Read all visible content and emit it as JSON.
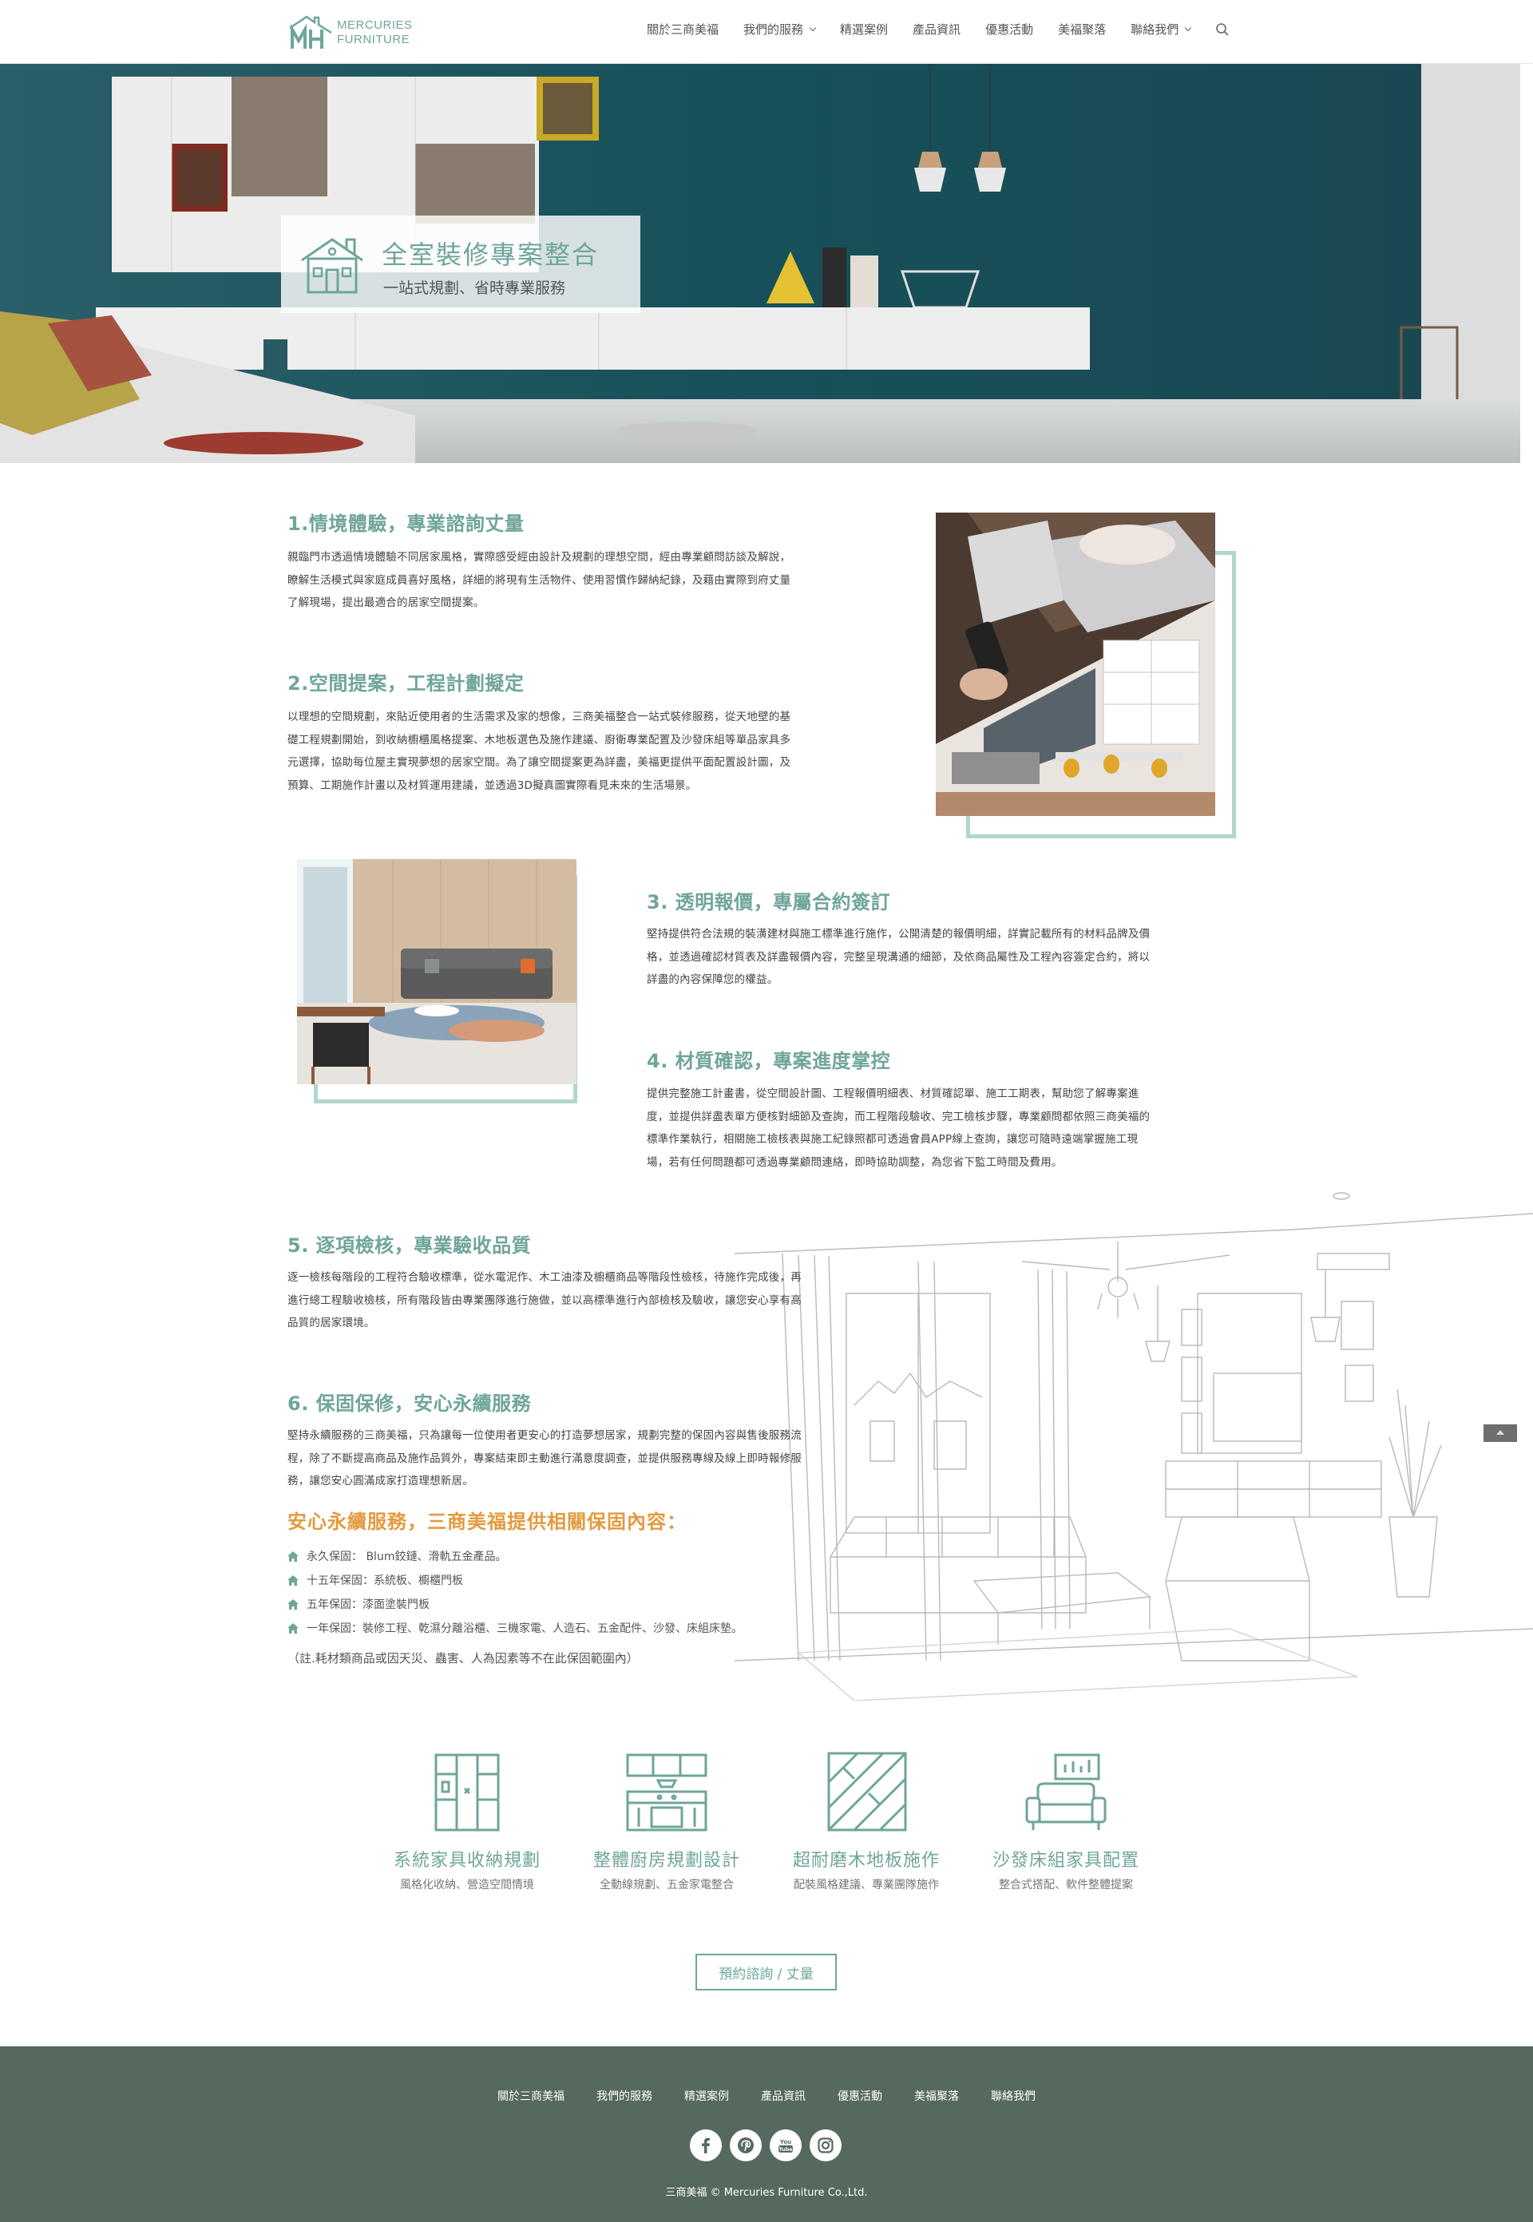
{
  "header": {
    "logo_line1": "MERCURIES",
    "logo_line2": "FURNITURE",
    "nav": [
      {
        "label": "關於三商美福"
      },
      {
        "label": "我們的服務"
      },
      {
        "label": "精選案例"
      },
      {
        "label": "產品資訊"
      },
      {
        "label": "優惠活動"
      },
      {
        "label": "美福聚落"
      },
      {
        "label": "聯絡我們"
      }
    ],
    "search_icon": "search-icon"
  },
  "hero": {
    "title": "全室裝修專案整合",
    "subtitle": "一站式規劃、省時專業服務"
  },
  "sections": [
    {
      "title": "1.情境體驗，專業諮詢丈量",
      "lines": [
        "親臨門市透過情境體驗不同居家風格，實際感受經由設計及規劃的理想空間，經由專業顧問訪談及解說，",
        "瞭解生活模式與家庭成員喜好風格，詳細的將現有生活物件、使用習慣作歸納紀錄，及藉由實際到府丈量",
        "了解現場，提出最適合的居家空間提案。"
      ]
    },
    {
      "title": "2.空間提案，工程計劃擬定",
      "lines": [
        "以理想的空間規劃，來貼近使用者的生活需求及家的想像，三商美福整合一站式裝修服務，從天地壁的基",
        "礎工程規劃開始，到收納櫥櫃風格提案、木地板選色及施作建議、廚衛專業配置及沙發床組等單品家具多",
        "元選擇，協助每位屋主實現夢想的居家空間。為了讓空間提案更為詳盡，美福更提供平面配置設計圖，及",
        "預算、工期施作計畫以及材質運用建議，並透過3D擬真圖實際看見未來的生活場景。"
      ]
    },
    {
      "title": "3. 透明報價，專屬合約簽訂",
      "lines": [
        "堅持提供符合法規的裝潢建材與施工標準進行施作，公開清楚的報價明細，詳實記載所有的材料品牌及價",
        "格，並透過確認材質表及詳盡報價內容，完整呈現溝通的細節，及依商品屬性及工程內容簽定合約，將以",
        "詳盡的內容保障您的權益。"
      ]
    },
    {
      "title": "4. 材質確認，專案進度掌控",
      "lines": [
        "提供完整施工計畫書，從空間設計圖、工程報價明細表、材質確認單、施工工期表，幫助您了解專案進",
        "度，並提供詳盡表單方便核對細節及查詢，而工程階段驗收、完工檢核步驟，專業顧問都依照三商美福的",
        "標準作業執行，相關施工檢核表與施工紀錄照都可透過會員APP線上查詢，讓您可隨時遠端掌握施工現",
        "場，若有任何問題都可透過專業顧問連絡，即時協助調整，為您省下監工時間及費用。"
      ]
    },
    {
      "title": "5. 逐項檢核，專業驗收品質",
      "lines": [
        "逐一檢核每階段的工程符合驗收標準，從水電泥作、木工油漆及櫥櫃商品等階段性檢核，待施作完成後，再",
        "進行總工程驗收檢核，所有階段皆由專業團隊進行施做，並以高標準進行內部檢核及驗收，讓您安心享有高",
        "品質的居家環境。"
      ]
    },
    {
      "title": "6. 保固保修，安心永續服務",
      "lines": [
        "堅持永續服務的三商美福，只為讓每一位使用者更安心的打造夢想居家，規劃完整的保固內容與售後服務流",
        "程，除了不斷提高商品及施作品質外，專案結束即主動進行滿意度調查，並提供服務專線及線上即時報修服",
        "務，讓您安心圓滿成家打造理想新居。"
      ]
    }
  ],
  "guarantee": {
    "title": "安心永續服務，三商美福提供相關保固內容：",
    "items": [
      "永久保固： Blum鉸鏈、滑軌五金產品。",
      "十五年保固：系統板、櫥櫃門板",
      "五年保固：漆面塗裝門板",
      "一年保固：裝修工程、乾濕分離浴櫃、三機家電、人造石、五金配件、沙發、床組床墊。"
    ],
    "item_icon": "home-bullet-icon",
    "note": "（註.耗材類商品或因天災、蟲害、人為因素等不在此保固範圍內）"
  },
  "services": [
    {
      "icon": "cabinet-icon",
      "title": "系統家具收納規劃",
      "subtitle": "風格化收納、營造空間情境"
    },
    {
      "icon": "kitchen-icon",
      "title": "整體廚房規劃設計",
      "subtitle": "全動線規劃、五金家電整合"
    },
    {
      "icon": "wood-floor-icon",
      "title": "超耐磨木地板施作",
      "subtitle": "配裝風格建議、專業團隊施作"
    },
    {
      "icon": "sofa-icon",
      "title": "沙發床組家具配置",
      "subtitle": "整合式搭配、軟件整體提案"
    }
  ],
  "cta_label": "預約諮詢 / 丈量",
  "footer": {
    "nav": [
      "關於三商美福",
      "我們的服務",
      "精選案例",
      "產品資訊",
      "優惠活動",
      "美福聚落",
      "聯絡我們"
    ],
    "social": [
      "facebook-icon",
      "pinterest-icon",
      "youtube-icon",
      "instagram-icon"
    ],
    "copyright": "三商美福 © Mercuries Furniture Co.,Ltd."
  },
  "colors": {
    "accent": "#6fa59a",
    "frame": "#b2d6cf",
    "orange": "#e39a3f",
    "footer": "#56695f",
    "hero_wall": "#1d4e58"
  }
}
